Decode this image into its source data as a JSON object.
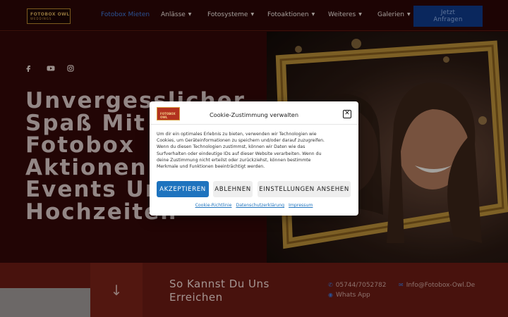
{
  "nav": {
    "logo_text": "FOTOBOX OWL",
    "logo_sub": "WEDDINGS",
    "items": [
      {
        "label": "Fotobox Mieten"
      },
      {
        "label": "Anlässe"
      },
      {
        "label": "Fotosysteme"
      },
      {
        "label": "Fotoaktionen"
      },
      {
        "label": "Weiteres"
      },
      {
        "label": "Galerien"
      }
    ],
    "cta_line1": "Jetzt",
    "cta_line2": "Anfragen",
    "active_color": "#3f77d7"
  },
  "social": [
    {
      "icon": "facebook-icon"
    },
    {
      "icon": "youtube-icon"
    },
    {
      "icon": "instagram-icon"
    }
  ],
  "hero": {
    "title_lines": [
      "Unvergesslicher",
      "Spaß Mit",
      "Fotobox",
      "Aktionen Auf",
      "Events Und",
      "Hochzeiten"
    ]
  },
  "contact": {
    "title_line1": "So Kannst Du Uns",
    "title_line2": "Erreichen",
    "phone": "05744/7052782",
    "email": "Info@Fotobox-Owl.De",
    "whatsapp": "Whats App"
  },
  "cookie": {
    "title": "Cookie-Zustimmung verwalten",
    "body_lines": [
      "Um dir ein optimales Erlebnis zu bieten, verwenden wir Technologien wie",
      "Cookies, um Geräteinformationen zu speichern und/oder darauf zuzugreifen.",
      "Wenn du diesen Technologien zustimmst, können wir Daten wie das",
      "Surfverhalten oder eindeutige IDs auf dieser Website verarbeiten. Wenn du",
      "deine Zustimmung nicht erteilst oder zurückziehst, können bestimmte",
      "Merkmale und Funktionen beeinträchtigt werden."
    ],
    "accept_label": "AKZEPTIEREN",
    "deny_label": "ABLEHNEN",
    "settings_label": "EINSTELLUNGEN ANSEHEN",
    "links": [
      "Cookie-Richtlinie",
      "Datenschutzerklärung",
      "Impressum"
    ],
    "accent_color": "#1e73be"
  }
}
